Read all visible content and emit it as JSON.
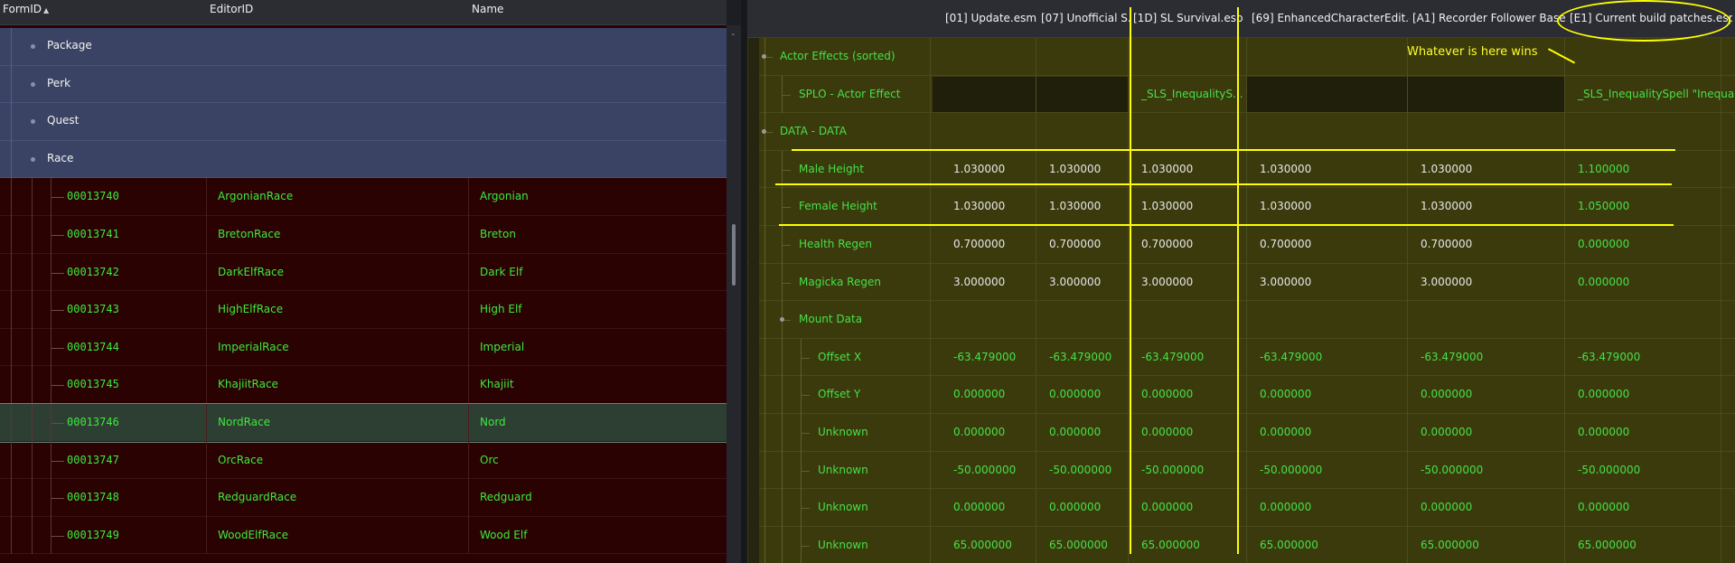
{
  "left_header": {
    "formid": "FormID",
    "editorid": "EditorID",
    "name": "Name"
  },
  "groups": [
    {
      "label": "Package"
    },
    {
      "label": "Perk"
    },
    {
      "label": "Quest"
    },
    {
      "label": "Race"
    }
  ],
  "records": [
    {
      "formid": "00013740",
      "editorid": "ArgonianRace",
      "name": "Argonian"
    },
    {
      "formid": "00013741",
      "editorid": "BretonRace",
      "name": "Breton"
    },
    {
      "formid": "00013742",
      "editorid": "DarkElfRace",
      "name": "Dark Elf"
    },
    {
      "formid": "00013743",
      "editorid": "HighElfRace",
      "name": "High Elf"
    },
    {
      "formid": "00013744",
      "editorid": "ImperialRace",
      "name": "Imperial"
    },
    {
      "formid": "00013745",
      "editorid": "KhajiitRace",
      "name": "Khajiit"
    },
    {
      "formid": "00013746",
      "editorid": "NordRace",
      "name": "Nord",
      "selected": true
    },
    {
      "formid": "00013747",
      "editorid": "OrcRace",
      "name": "Orc"
    },
    {
      "formid": "00013748",
      "editorid": "RedguardRace",
      "name": "Redguard"
    },
    {
      "formid": "00013749",
      "editorid": "WoodElfRace",
      "name": "Wood Elf"
    }
  ],
  "plugins": [
    "[01] Update.esm",
    "[07] Unofficial S...",
    "[1D] SL Survival.esp",
    "[69] EnhancedCharacterEdit.esp",
    "[A1] Recorder Follower Base.esp",
    "[E1] Current build patches.esp"
  ],
  "right_rows": [
    {
      "label": "Actor Effects (sorted)",
      "level": 0,
      "node": true,
      "values": [
        "",
        "",
        "",
        "",
        "",
        ""
      ]
    },
    {
      "label": "SPLO - Actor Effect",
      "level": 1,
      "values": [
        "",
        "",
        "_SLS_InequalityS...",
        "",
        "",
        "_SLS_InequalitySpell \"Inequality\" ..."
      ]
    },
    {
      "label": "DATA - DATA",
      "level": 0,
      "node": true,
      "values": [
        "",
        "",
        "",
        "",
        "",
        ""
      ]
    },
    {
      "label": "Male Height",
      "level": 1,
      "values": [
        "1.030000",
        "1.030000",
        "1.030000",
        "1.030000",
        "1.030000",
        "1.100000"
      ]
    },
    {
      "label": "Female Height",
      "level": 1,
      "values": [
        "1.030000",
        "1.030000",
        "1.030000",
        "1.030000",
        "1.030000",
        "1.050000"
      ]
    },
    {
      "label": "Health Regen",
      "level": 1,
      "values": [
        "0.700000",
        "0.700000",
        "0.700000",
        "0.700000",
        "0.700000",
        "0.000000"
      ]
    },
    {
      "label": "Magicka Regen",
      "level": 1,
      "values": [
        "3.000000",
        "3.000000",
        "3.000000",
        "3.000000",
        "3.000000",
        "0.000000"
      ]
    },
    {
      "label": "Mount Data",
      "level": 1,
      "node": true,
      "values": [
        "",
        "",
        "",
        "",
        "",
        ""
      ]
    },
    {
      "label": "Offset X",
      "level": 2,
      "values": [
        "-63.479000",
        "-63.479000",
        "-63.479000",
        "-63.479000",
        "-63.479000",
        "-63.479000"
      ]
    },
    {
      "label": "Offset Y",
      "level": 2,
      "values": [
        "0.000000",
        "0.000000",
        "0.000000",
        "0.000000",
        "0.000000",
        "0.000000"
      ]
    },
    {
      "label": "Unknown",
      "level": 2,
      "values": [
        "0.000000",
        "0.000000",
        "0.000000",
        "0.000000",
        "0.000000",
        "0.000000"
      ]
    },
    {
      "label": "Unknown",
      "level": 2,
      "values": [
        "-50.000000",
        "-50.000000",
        "-50.000000",
        "-50.000000",
        "-50.000000",
        "-50.000000"
      ]
    },
    {
      "label": "Unknown",
      "level": 2,
      "values": [
        "0.000000",
        "0.000000",
        "0.000000",
        "0.000000",
        "0.000000",
        "0.000000"
      ]
    },
    {
      "label": "Unknown",
      "level": 2,
      "values": [
        "65.000000",
        "65.000000",
        "65.000000",
        "65.000000",
        "65.000000",
        "65.000000"
      ]
    }
  ],
  "annotation": {
    "text": "Whatever is here wins"
  },
  "colors": {
    "left_bg": "#2a0202",
    "group_bg": "#3a4363",
    "right_bg": "#3a3a0d",
    "text_green": "#46e046",
    "annotation_yellow": "#ffff00"
  }
}
